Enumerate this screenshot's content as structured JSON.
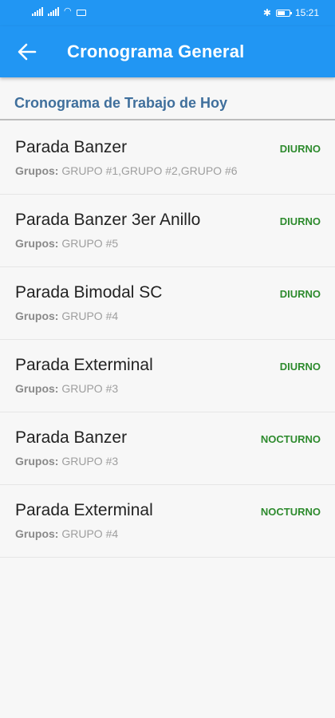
{
  "status_bar": {
    "time": "15:21"
  },
  "app_bar": {
    "title": "Cronograma General"
  },
  "section": {
    "title": "Cronograma de Trabajo de Hoy"
  },
  "groups_label": "Grupos:",
  "items": [
    {
      "title": "Parada Banzer",
      "shift": "DIURNO",
      "groups": "GRUPO #1,GRUPO #2,GRUPO #6"
    },
    {
      "title": "Parada Banzer 3er Anillo",
      "shift": "DIURNO",
      "groups": "GRUPO #5"
    },
    {
      "title": "Parada Bimodal SC",
      "shift": "DIURNO",
      "groups": "GRUPO #4"
    },
    {
      "title": "Parada Exterminal",
      "shift": "DIURNO",
      "groups": "GRUPO #3"
    },
    {
      "title": "Parada Banzer",
      "shift": "NOCTURNO",
      "groups": "GRUPO #3"
    },
    {
      "title": "Parada Exterminal",
      "shift": "NOCTURNO",
      "groups": "GRUPO #4"
    }
  ],
  "colors": {
    "primary": "#2196f3",
    "section_title": "#3f6f9c",
    "shift": "#2e8b2e"
  }
}
